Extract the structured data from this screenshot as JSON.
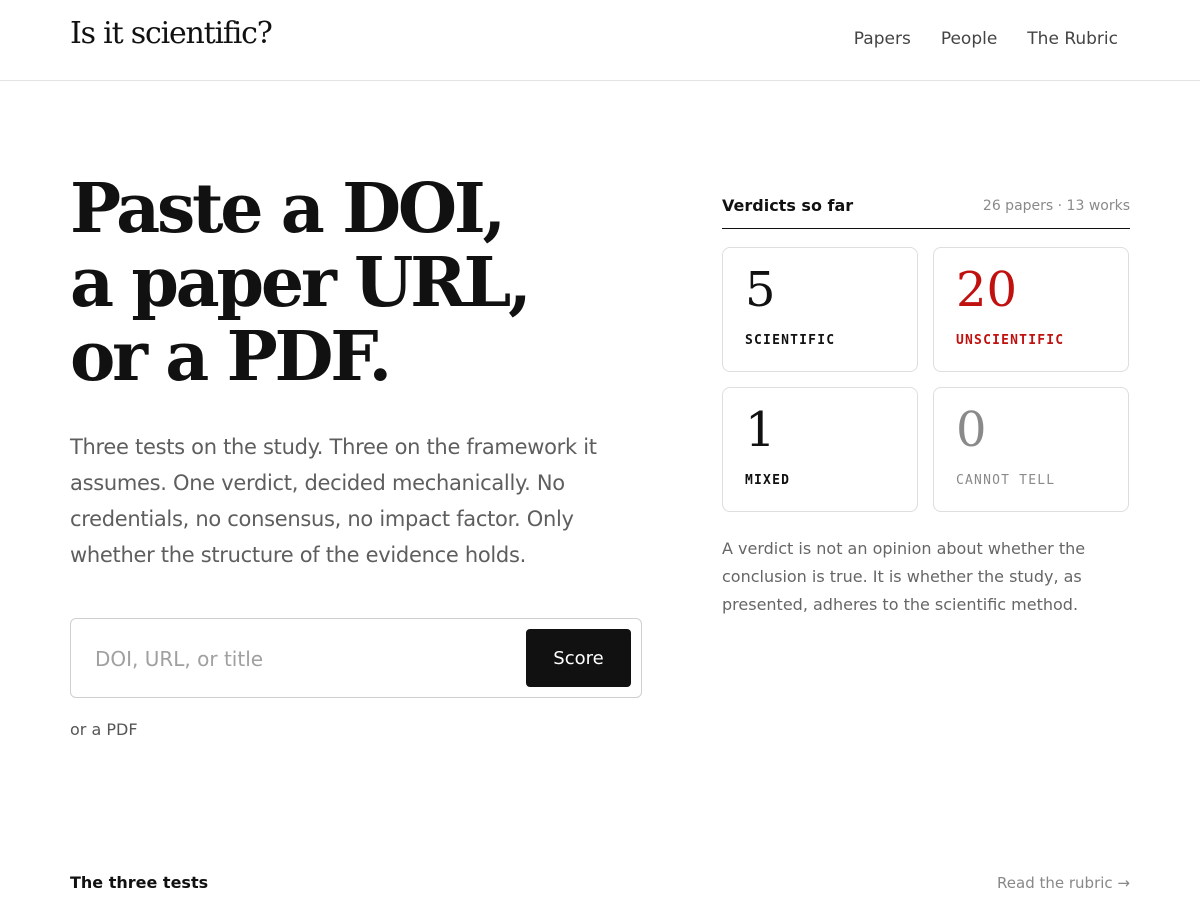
{
  "header": {
    "logo": "Is it scientific?",
    "nav": [
      "Papers",
      "People",
      "The Rubric"
    ]
  },
  "hero": {
    "title_lines": [
      "Paste a DOI,",
      "a paper URL,",
      "or a PDF."
    ],
    "lede": "Three tests on the study. Three on the framework it assumes. One verdict, decided mechanically. No credentials, no consensus, no impact factor. Only whether the structure of the evidence holds."
  },
  "search": {
    "placeholder": "DOI, URL, or title",
    "button": "Score",
    "pdf_link": "or a PDF"
  },
  "verdicts": {
    "title": "Verdicts so far",
    "meta": "26 papers · 13 works",
    "cards": [
      {
        "count": "5",
        "label": "SCIENTIFIC"
      },
      {
        "count": "20",
        "label": "UNSCIENTIFIC"
      },
      {
        "count": "1",
        "label": "MIXED"
      },
      {
        "count": "0",
        "label": "CANNOT TELL"
      }
    ],
    "note": "A verdict is not an opinion about whether the conclusion is true. It is whether the study, as presented, adheres to the scientific method.",
    "colors": {
      "scientific": "#111111",
      "unscientific": "#c0110f",
      "cannot_tell": "#8a8a8a"
    }
  },
  "tests_section": {
    "title": "The three tests",
    "link": "Read the rubric →"
  }
}
